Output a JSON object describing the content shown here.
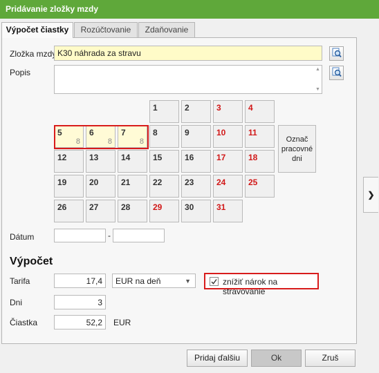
{
  "window": {
    "title": "Pridávanie zložky mzdy"
  },
  "tabs": [
    {
      "label": "Výpočet čiastky",
      "active": true
    },
    {
      "label": "Rozúčtovanie",
      "active": false
    },
    {
      "label": "Zdaňovanie",
      "active": false
    }
  ],
  "form": {
    "component_label": "Zložka mzdy",
    "component_value": "K30  náhrada za stravu",
    "description_label": "Popis",
    "description_value": "",
    "date_label": "Dátum",
    "date_from": "",
    "date_separator": "-",
    "date_to": ""
  },
  "calendar": {
    "days": [
      {
        "n": "1",
        "red": false,
        "sel": false,
        "sub": ""
      },
      {
        "n": "2",
        "red": false,
        "sel": false,
        "sub": ""
      },
      {
        "n": "3",
        "red": true,
        "sel": false,
        "sub": ""
      },
      {
        "n": "4",
        "red": true,
        "sel": false,
        "sub": ""
      },
      {
        "n": "5",
        "red": false,
        "sel": true,
        "sub": "8"
      },
      {
        "n": "6",
        "red": false,
        "sel": true,
        "sub": "8"
      },
      {
        "n": "7",
        "red": false,
        "sel": true,
        "sub": "8"
      },
      {
        "n": "8",
        "red": false,
        "sel": false,
        "sub": ""
      },
      {
        "n": "9",
        "red": false,
        "sel": false,
        "sub": ""
      },
      {
        "n": "10",
        "red": true,
        "sel": false,
        "sub": ""
      },
      {
        "n": "11",
        "red": true,
        "sel": false,
        "sub": ""
      },
      {
        "n": "12",
        "red": false,
        "sel": false,
        "sub": ""
      },
      {
        "n": "13",
        "red": false,
        "sel": false,
        "sub": ""
      },
      {
        "n": "14",
        "red": false,
        "sel": false,
        "sub": ""
      },
      {
        "n": "15",
        "red": false,
        "sel": false,
        "sub": ""
      },
      {
        "n": "16",
        "red": false,
        "sel": false,
        "sub": ""
      },
      {
        "n": "17",
        "red": true,
        "sel": false,
        "sub": ""
      },
      {
        "n": "18",
        "red": true,
        "sel": false,
        "sub": ""
      },
      {
        "n": "19",
        "red": false,
        "sel": false,
        "sub": ""
      },
      {
        "n": "20",
        "red": false,
        "sel": false,
        "sub": ""
      },
      {
        "n": "21",
        "red": false,
        "sel": false,
        "sub": ""
      },
      {
        "n": "22",
        "red": false,
        "sel": false,
        "sub": ""
      },
      {
        "n": "23",
        "red": false,
        "sel": false,
        "sub": ""
      },
      {
        "n": "24",
        "red": true,
        "sel": false,
        "sub": ""
      },
      {
        "n": "25",
        "red": true,
        "sel": false,
        "sub": ""
      },
      {
        "n": "26",
        "red": false,
        "sel": false,
        "sub": ""
      },
      {
        "n": "27",
        "red": false,
        "sel": false,
        "sub": ""
      },
      {
        "n": "28",
        "red": false,
        "sel": false,
        "sub": ""
      },
      {
        "n": "29",
        "red": true,
        "sel": false,
        "sub": ""
      },
      {
        "n": "30",
        "red": false,
        "sel": false,
        "sub": ""
      },
      {
        "n": "31",
        "red": true,
        "sel": false,
        "sub": ""
      }
    ],
    "mark_button_label": "Označ pracovné dni"
  },
  "calc": {
    "title": "Výpočet",
    "rate_label": "Tarifa",
    "rate_value": "17,4",
    "unit_selected": "EUR na deň",
    "reduce_label": "znížiť nárok na stravovanie",
    "reduce_checked": true,
    "days_label": "Dni",
    "days_value": "3",
    "amount_label": "Čiastka",
    "amount_value": "52,2",
    "currency": "EUR"
  },
  "buttons": {
    "add_next": "Pridaj ďalšiu",
    "ok": "Ok",
    "cancel": "Zruš"
  },
  "icons": {
    "lookup": "search-icon",
    "side_arrow": "chevron-right-icon",
    "dropdown": "chevron-down-icon",
    "check": "checkmark-icon"
  },
  "colors": {
    "titlebar": "#5fa83a",
    "highlight_red": "#d81b1b",
    "weekend_red": "#d11818",
    "field_yellow": "#fffbc8"
  }
}
